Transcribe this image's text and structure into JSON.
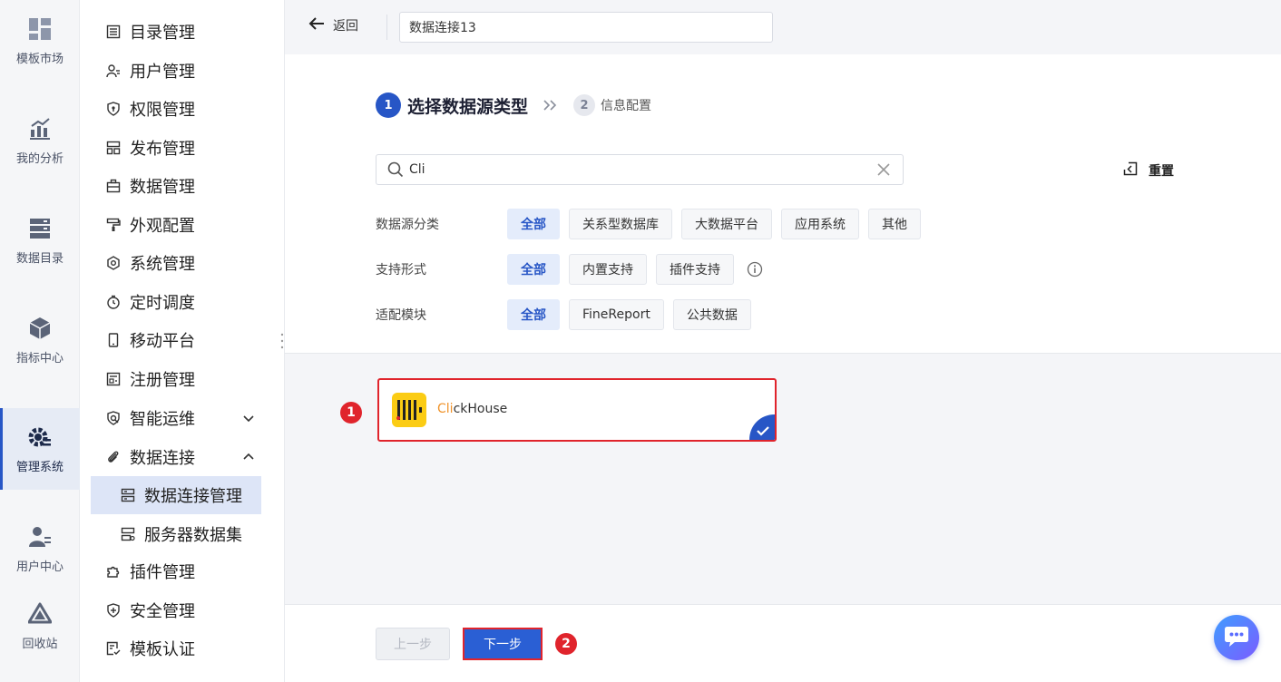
{
  "rail": {
    "items": [
      {
        "label": "模板市场",
        "icon": "template-grid-icon"
      },
      {
        "label": "我的分析",
        "icon": "analysis-chart-icon"
      },
      {
        "label": "数据目录",
        "icon": "data-catalog-icon"
      },
      {
        "label": "指标中心",
        "icon": "metric-cube-icon"
      },
      {
        "label": "管理系统",
        "icon": "management-gear-icon"
      },
      {
        "label": "用户中心",
        "icon": "user-center-icon"
      },
      {
        "label": "回收站",
        "icon": "recycle-bin-icon"
      }
    ],
    "active_index": 4
  },
  "menu": {
    "items": [
      {
        "label": "目录管理",
        "icon": "catalog-list-icon"
      },
      {
        "label": "用户管理",
        "icon": "user-manage-icon"
      },
      {
        "label": "权限管理",
        "icon": "shield-lock-icon"
      },
      {
        "label": "发布管理",
        "icon": "publish-layout-icon"
      },
      {
        "label": "数据管理",
        "icon": "data-briefcase-icon"
      },
      {
        "label": "外观配置",
        "icon": "paint-roller-icon"
      },
      {
        "label": "系统管理",
        "icon": "settings-gear-icon"
      },
      {
        "label": "定时调度",
        "icon": "timer-icon"
      },
      {
        "label": "移动平台",
        "icon": "mobile-phone-icon"
      },
      {
        "label": "注册管理",
        "icon": "register-form-icon"
      },
      {
        "label": "智能运维",
        "icon": "smart-ops-icon"
      },
      {
        "label": "数据连接",
        "icon": "paperclip-link-icon"
      },
      {
        "label": "插件管理",
        "icon": "puzzle-plugin-icon"
      },
      {
        "label": "安全管理",
        "icon": "shield-plus-icon"
      },
      {
        "label": "模板认证",
        "icon": "template-cert-icon"
      }
    ],
    "sub_items": [
      {
        "label": "数据连接管理",
        "icon": "connection-manage-icon"
      },
      {
        "label": "服务器数据集",
        "icon": "server-dataset-icon"
      }
    ]
  },
  "topbar": {
    "back_label": "返回",
    "name_value": "数据连接13"
  },
  "steps": {
    "step1_num": "1",
    "step1_label": "选择数据源类型",
    "step2_num": "2",
    "step2_label": "信息配置"
  },
  "search": {
    "value": "Cli",
    "reset_label": "重置"
  },
  "filters": [
    {
      "label": "数据源分类",
      "tags": [
        "全部",
        "关系型数据库",
        "大数据平台",
        "应用系统",
        "其他"
      ],
      "selected": 0
    },
    {
      "label": "支持形式",
      "tags": [
        "全部",
        "内置支持",
        "插件支持"
      ],
      "selected": 0
    },
    {
      "label": "适配模块",
      "tags": [
        "全部",
        "FineReport",
        "公共数据"
      ],
      "selected": 0
    }
  ],
  "result_card": {
    "name_highlight": "Cli",
    "name_rest": "ckHouse",
    "selected": true
  },
  "annotations": {
    "badge1": "1",
    "badge2": "2"
  },
  "footer": {
    "prev_label": "上一步",
    "next_label": "下一步"
  },
  "colors": {
    "accent": "#2756c6",
    "highlight_red": "#e0242c",
    "clickhouse_yellow": "#fbcc14",
    "search_match": "#f0932a"
  }
}
